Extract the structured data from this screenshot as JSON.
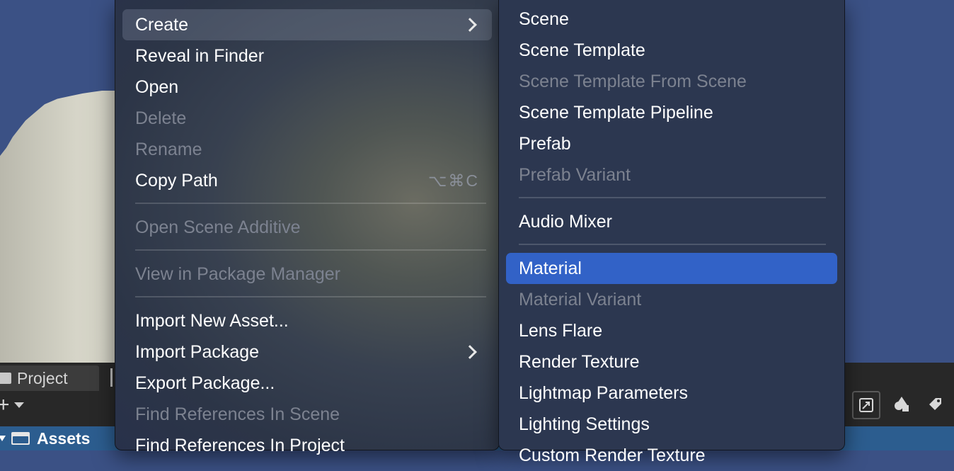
{
  "editor": {
    "project_tab_label": "Project",
    "assets_label": "Assets",
    "add_symbol": "+"
  },
  "context_menu": {
    "items": [
      {
        "label": "Create",
        "enabled": true,
        "submenu": true
      },
      {
        "label": "Reveal in Finder",
        "enabled": true
      },
      {
        "label": "Open",
        "enabled": true
      },
      {
        "label": "Delete",
        "enabled": false
      },
      {
        "label": "Rename",
        "enabled": false
      },
      {
        "label": "Copy Path",
        "enabled": true,
        "shortcut": "⌥⌘C"
      },
      {
        "label": "Open Scene Additive",
        "enabled": false
      },
      {
        "label": "View in Package Manager",
        "enabled": false
      },
      {
        "label": "Import New Asset...",
        "enabled": true
      },
      {
        "label": "Import Package",
        "enabled": true,
        "submenu": true
      },
      {
        "label": "Export Package...",
        "enabled": true
      },
      {
        "label": "Find References In Scene",
        "enabled": false
      },
      {
        "label": "Find References In Project",
        "enabled": true
      }
    ]
  },
  "create_submenu": {
    "items": [
      {
        "label": "Scene",
        "enabled": true
      },
      {
        "label": "Scene Template",
        "enabled": true
      },
      {
        "label": "Scene Template From Scene",
        "enabled": false
      },
      {
        "label": "Scene Template Pipeline",
        "enabled": true
      },
      {
        "label": "Prefab",
        "enabled": true
      },
      {
        "label": "Prefab Variant",
        "enabled": false
      },
      {
        "label": "Audio Mixer",
        "enabled": true
      },
      {
        "label": "Material",
        "enabled": true,
        "selected": true
      },
      {
        "label": "Material Variant",
        "enabled": false
      },
      {
        "label": "Lens Flare",
        "enabled": true
      },
      {
        "label": "Render Texture",
        "enabled": true
      },
      {
        "label": "Lightmap Parameters",
        "enabled": true
      },
      {
        "label": "Lighting Settings",
        "enabled": true
      },
      {
        "label": "Custom Render Texture",
        "enabled": true
      }
    ]
  },
  "colors": {
    "selection": "#3262c7",
    "scene_background": "#3b5185",
    "disabled_text": "#7c8290"
  }
}
